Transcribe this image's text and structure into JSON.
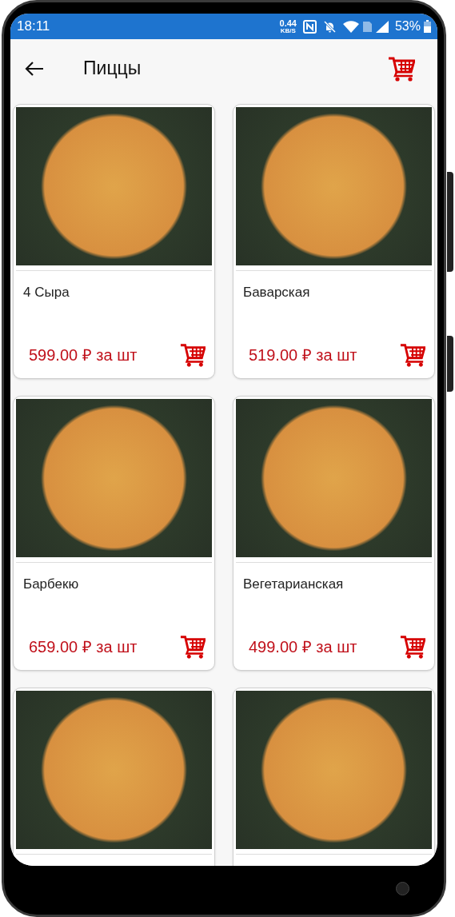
{
  "status_bar": {
    "time": "18:11",
    "speed": "0.44",
    "speed_unit": "KB/S",
    "battery": "53%"
  },
  "app_bar": {
    "title": "Пиццы"
  },
  "products": [
    {
      "kind": "full",
      "name": "4 Сыра",
      "price": "599.00 ₽ за шт"
    },
    {
      "kind": "full",
      "name": "Баварская",
      "price": "519.00 ₽ за шт"
    },
    {
      "kind": "full",
      "name": "Барбекю",
      "price": "659.00 ₽ за шт"
    },
    {
      "kind": "full",
      "name": "Вегетарианская",
      "price": "499.00 ₽ за шт"
    },
    {
      "kind": "partial"
    },
    {
      "kind": "partial"
    }
  ]
}
